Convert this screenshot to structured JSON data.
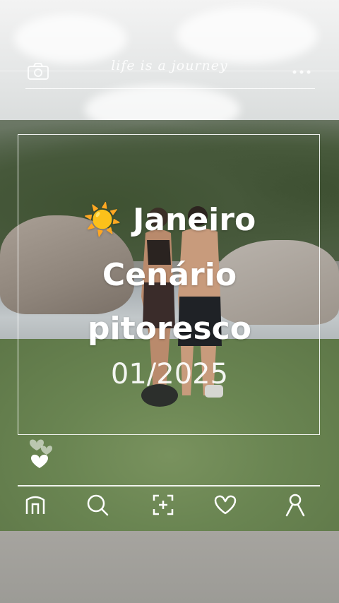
{
  "header": {
    "tagline": "life is a journey",
    "camera_icon": "camera-icon",
    "more_icon": "more-dots-icon"
  },
  "caption": {
    "emoji": "☀️",
    "line1": "Janeiro",
    "line2": "Cenário",
    "line3": "pitoresco",
    "date": "01/2025"
  },
  "reactions": {
    "icon": "hearts-icon"
  },
  "bottom_nav": {
    "items": [
      "home-icon",
      "search-icon",
      "add-icon",
      "heart-icon",
      "profile-icon"
    ]
  },
  "colors": {
    "overlay": "#ffffff",
    "grass": "#6a8552"
  }
}
